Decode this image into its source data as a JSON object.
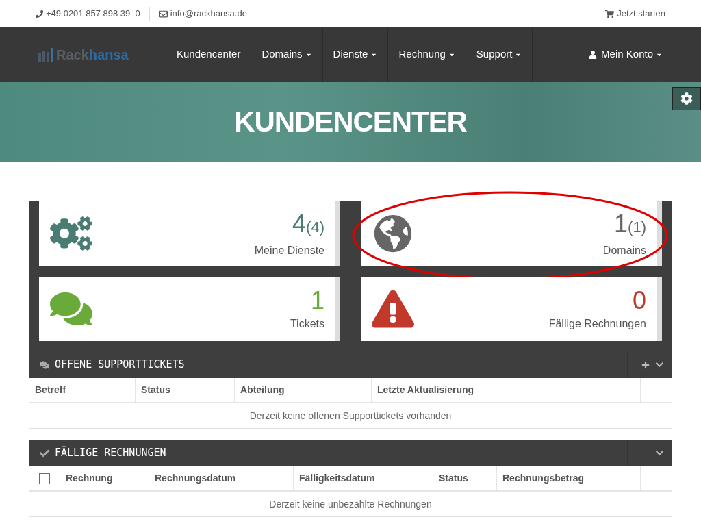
{
  "topbar": {
    "phone": "+49 0201 857 898 39–0",
    "email": "info@rackhansa.de",
    "cta": "Jetzt starten"
  },
  "logo": {
    "parts": [
      "Rack",
      "hansa"
    ]
  },
  "nav": {
    "items": [
      {
        "label": "Kundencenter",
        "dropdown": false
      },
      {
        "label": "Domains",
        "dropdown": true
      },
      {
        "label": "Dienste",
        "dropdown": true
      },
      {
        "label": "Rechnung",
        "dropdown": true
      },
      {
        "label": "Support",
        "dropdown": true
      }
    ],
    "account": {
      "label": "Mein Konto",
      "dropdown": true
    }
  },
  "hero": {
    "title": "KUNDENCENTER"
  },
  "stats": [
    {
      "kind": "services",
      "value": "4",
      "extra": "(4)",
      "label": "Meine Dienste",
      "color": "#4a7c73",
      "highlighted": false
    },
    {
      "kind": "domains",
      "value": "1",
      "extra": "(1)",
      "label": "Domains",
      "color": "#666666",
      "highlighted": true
    },
    {
      "kind": "tickets",
      "value": "1",
      "label": "Tickets",
      "color": "#6aaa3a",
      "highlighted": false
    },
    {
      "kind": "invoices",
      "value": "0",
      "label": "Fällige Rechnungen",
      "color": "#c0392b",
      "highlighted": false
    }
  ],
  "panels": [
    {
      "kind": "tickets",
      "title": "OFFENE SUPPORTTICKETS",
      "add": true,
      "columns": [
        "Betreff",
        "Status",
        "Abteilung",
        "Letzte Aktualisierung"
      ],
      "empty": "Derzeit keine offenen Supporttickets vorhanden"
    },
    {
      "kind": "invoices",
      "title": "FÄLLIGE RECHNUNGEN",
      "add": false,
      "select_all": {
        "checked": false
      },
      "columns": [
        "Rechnung",
        "Rechnungsdatum",
        "Fälligkeitsdatum",
        "Status",
        "Rechnungsbetrag"
      ],
      "empty": "Derzeit keine unbezahlte Rechnungen"
    }
  ]
}
